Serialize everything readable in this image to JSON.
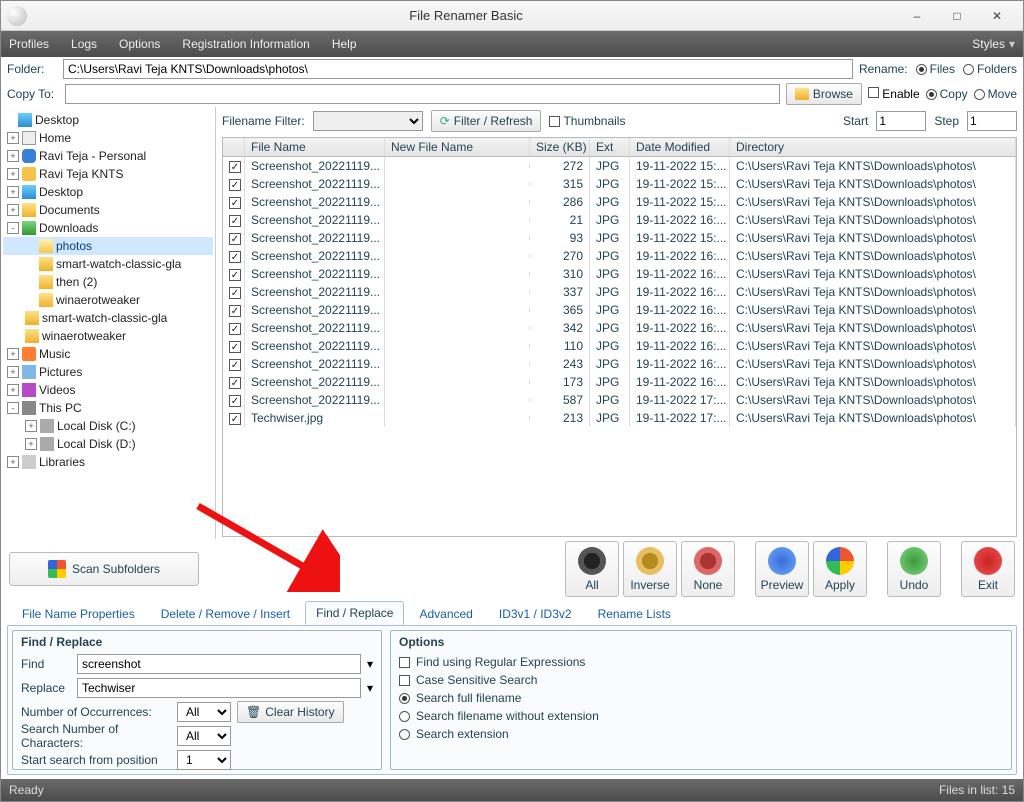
{
  "window": {
    "title": "File Renamer Basic",
    "styles": "Styles"
  },
  "menu": [
    "Profiles",
    "Logs",
    "Options",
    "Registration Information",
    "Help"
  ],
  "folder": {
    "label": "Folder:",
    "path": "C:\\Users\\Ravi Teja KNTS\\Downloads\\photos\\",
    "rename_label": "Rename:",
    "radio_files": "Files",
    "radio_folders": "Folders"
  },
  "copyto": {
    "label": "Copy To:",
    "browse": "Browse",
    "enable": "Enable",
    "radio_copy": "Copy",
    "radio_move": "Move"
  },
  "filterbar": {
    "filename_filter": "Filename Filter:",
    "filter_refresh": "Filter / Refresh",
    "thumbs": "Thumbnails",
    "start_label": "Start",
    "start_val": "1",
    "step_label": "Step",
    "step_val": "1"
  },
  "columns": {
    "filename": "File Name",
    "newfilename": "New File Name",
    "size": "Size (KB)",
    "ext": "Ext",
    "modified": "Date Modified",
    "directory": "Directory"
  },
  "dir_path": "C:\\Users\\Ravi Teja KNTS\\Downloads\\photos\\",
  "rows": [
    {
      "fn": "Screenshot_20221119...",
      "sz": "272",
      "ext": "JPG",
      "dm": "19-11-2022 15:..."
    },
    {
      "fn": "Screenshot_20221119...",
      "sz": "315",
      "ext": "JPG",
      "dm": "19-11-2022 15:..."
    },
    {
      "fn": "Screenshot_20221119...",
      "sz": "286",
      "ext": "JPG",
      "dm": "19-11-2022 15:..."
    },
    {
      "fn": "Screenshot_20221119...",
      "sz": "21",
      "ext": "JPG",
      "dm": "19-11-2022 16:..."
    },
    {
      "fn": "Screenshot_20221119...",
      "sz": "93",
      "ext": "JPG",
      "dm": "19-11-2022 15:..."
    },
    {
      "fn": "Screenshot_20221119...",
      "sz": "270",
      "ext": "JPG",
      "dm": "19-11-2022 16:..."
    },
    {
      "fn": "Screenshot_20221119...",
      "sz": "310",
      "ext": "JPG",
      "dm": "19-11-2022 16:..."
    },
    {
      "fn": "Screenshot_20221119...",
      "sz": "337",
      "ext": "JPG",
      "dm": "19-11-2022 16:..."
    },
    {
      "fn": "Screenshot_20221119...",
      "sz": "365",
      "ext": "JPG",
      "dm": "19-11-2022 16:..."
    },
    {
      "fn": "Screenshot_20221119...",
      "sz": "342",
      "ext": "JPG",
      "dm": "19-11-2022 16:..."
    },
    {
      "fn": "Screenshot_20221119...",
      "sz": "110",
      "ext": "JPG",
      "dm": "19-11-2022 16:..."
    },
    {
      "fn": "Screenshot_20221119...",
      "sz": "243",
      "ext": "JPG",
      "dm": "19-11-2022 16:..."
    },
    {
      "fn": "Screenshot_20221119...",
      "sz": "173",
      "ext": "JPG",
      "dm": "19-11-2022 16:..."
    },
    {
      "fn": "Screenshot_20221119...",
      "sz": "587",
      "ext": "JPG",
      "dm": "19-11-2022 17:..."
    },
    {
      "fn": "Techwiser.jpg",
      "sz": "213",
      "ext": "JPG",
      "dm": "19-11-2022 17:..."
    }
  ],
  "tree": {
    "desktop": "Desktop",
    "home": "Home",
    "personal": "Ravi Teja - Personal",
    "knts": "Ravi Teja KNTS",
    "desk2": "Desktop",
    "docs": "Documents",
    "dl": "Downloads",
    "photos": "photos",
    "sw1": "smart-watch-classic-gla",
    "then": "then (2)",
    "wina": "winaerotweaker",
    "sw2": "smart-watch-classic-gla",
    "wina2": "winaerotweaker",
    "music": "Music",
    "pics": "Pictures",
    "vids": "Videos",
    "pc": "This PC",
    "c": "Local Disk (C:)",
    "d": "Local Disk (D:)",
    "libs": "Libraries"
  },
  "bigbtns": {
    "all": "All",
    "inverse": "Inverse",
    "none": "None",
    "preview": "Preview",
    "apply": "Apply",
    "undo": "Undo",
    "exit": "Exit"
  },
  "scan": "Scan Subfolders",
  "tabs": [
    "File Name Properties",
    "Delete / Remove / Insert",
    "Find / Replace",
    "Advanced",
    "ID3v1 / ID3v2",
    "Rename Lists"
  ],
  "findreplace": {
    "group": "Find / Replace",
    "find": "Find",
    "find_val": "screenshot",
    "replace": "Replace",
    "replace_val": "Techwiser",
    "num_occ": "Number of Occurrences:",
    "search_chars": "Search Number of Characters:",
    "start_pos": "Start search from position",
    "all": "All",
    "one": "1",
    "clear": "Clear History"
  },
  "options": {
    "group": "Options",
    "regex": "Find using Regular Expressions",
    "case": "Case Sensitive Search",
    "full": "Search full filename",
    "noext": "Search filename without extension",
    "ext": "Search extension"
  },
  "status": {
    "ready": "Ready",
    "count": "Files in list: 15"
  }
}
